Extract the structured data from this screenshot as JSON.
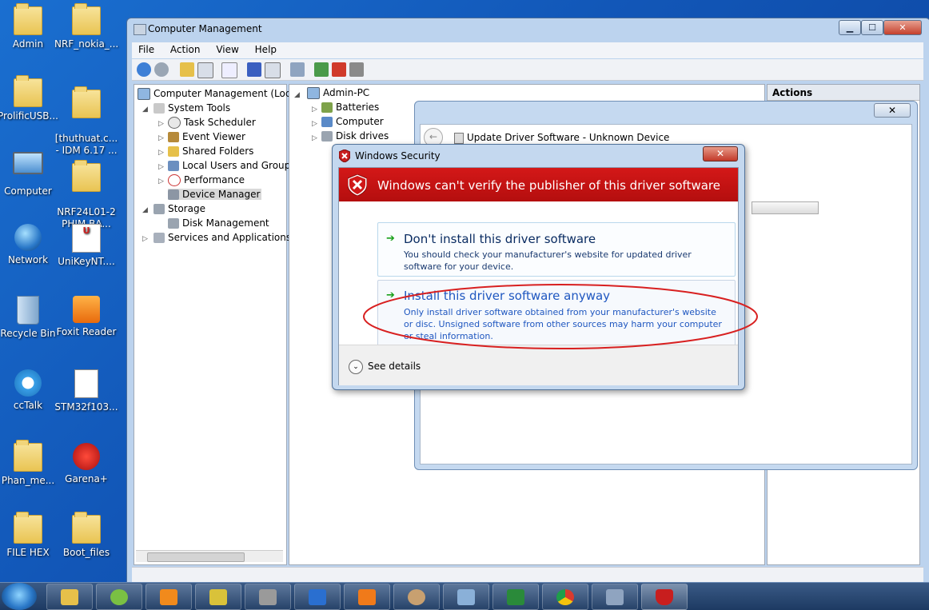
{
  "desktop": {
    "icons": [
      {
        "label": "Admin",
        "icon": "user-folder-icon"
      },
      {
        "label": "NRF_nokia_...",
        "icon": "folder-icon"
      },
      {
        "label": "ProlificUSB...",
        "icon": "folder-icon"
      },
      {
        "label": "[thuthuat.c...\n- IDM 6.17 ...",
        "icon": "folder-icon"
      },
      {
        "label": "Computer",
        "icon": "computer-icon"
      },
      {
        "label": "NRF24L01-2\nPHIM BA...",
        "icon": "folder-icon"
      },
      {
        "label": "Network",
        "icon": "network-icon"
      },
      {
        "label": "UniKeyNT....",
        "icon": "unikey-icon"
      },
      {
        "label": "Recycle Bin",
        "icon": "recycle-bin-icon"
      },
      {
        "label": "Foxit Reader",
        "icon": "foxit-icon"
      },
      {
        "label": "ccTalk",
        "icon": "cctalk-icon"
      },
      {
        "label": "STM32f103...",
        "icon": "document-icon"
      },
      {
        "label": "Phan_me...",
        "icon": "folder-icon"
      },
      {
        "label": "Garena+",
        "icon": "garena-icon"
      },
      {
        "label": "FILE HEX",
        "icon": "folder-icon"
      },
      {
        "label": "Boot_files",
        "icon": "folder-icon"
      }
    ]
  },
  "window": {
    "title": "Computer Management",
    "menu": [
      "File",
      "Action",
      "View",
      "Help"
    ],
    "controls": {
      "minimize": "▁",
      "maximize": "☐",
      "close": "✕"
    }
  },
  "left_tree": {
    "root": "Computer Management (Local",
    "items": [
      {
        "label": "System Tools",
        "level": 1
      },
      {
        "label": "Task Scheduler",
        "level": 2
      },
      {
        "label": "Event Viewer",
        "level": 2
      },
      {
        "label": "Shared Folders",
        "level": 2
      },
      {
        "label": "Local Users and Groups",
        "level": 2
      },
      {
        "label": "Performance",
        "level": 2
      },
      {
        "label": "Device Manager",
        "level": 2,
        "selected": true
      },
      {
        "label": "Storage",
        "level": 1
      },
      {
        "label": "Disk Management",
        "level": 2
      },
      {
        "label": "Services and Applications",
        "level": 1
      }
    ]
  },
  "device_tree": {
    "root": "Admin-PC",
    "items": [
      "Batteries",
      "Computer",
      "Disk drives"
    ]
  },
  "actions_pane": {
    "title": "Actions"
  },
  "update_dialog": {
    "title": "Update Driver Software - Unknown Device",
    "close": "✕"
  },
  "security_dialog": {
    "title": "Windows Security",
    "close": "✕",
    "banner": "Windows can't verify the publisher of this driver software",
    "options": [
      {
        "title": "Don't install this driver software",
        "desc": "You should check your manufacturer's website for updated driver software for your device."
      },
      {
        "title": "Install this driver software anyway",
        "desc": "Only install driver software obtained from your manufacturer's website or disc. Unsigned software from other sources may harm your computer or steal information."
      }
    ],
    "see_details": "See details"
  },
  "taskbar": {
    "apps": [
      "explorer-icon",
      "coccoc-icon",
      "media-player-icon",
      "tool-icon",
      "chip-icon",
      "isis-icon",
      "foxit-pdf-icon",
      "paint-icon",
      "keyboard-icon",
      "excel-icon",
      "chrome-icon",
      "computer-management-icon",
      "security-shield-icon"
    ]
  },
  "colors": {
    "banner_red": "#c81212",
    "link_blue": "#0a2c62",
    "green_arrow": "#19a01a"
  }
}
